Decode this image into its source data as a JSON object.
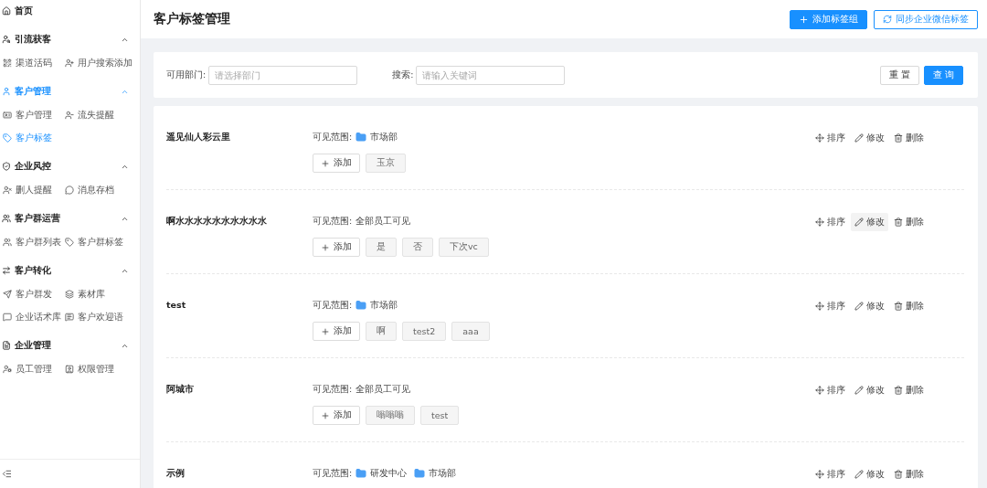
{
  "sidebar": {
    "home": {
      "label": "首页",
      "selected": false
    },
    "groups": [
      {
        "title": "引流获客",
        "expanded": true,
        "selected": false,
        "items": [
          {
            "label": "渠道活码",
            "selected": false
          },
          {
            "label": "用户搜索添加",
            "selected": false
          }
        ]
      },
      {
        "title": "客户管理",
        "expanded": true,
        "selected": true,
        "items": [
          {
            "label": "客户管理",
            "selected": false
          },
          {
            "label": "流失提醒",
            "selected": false
          },
          {
            "label": "客户标签",
            "selected": true
          }
        ]
      },
      {
        "title": "企业风控",
        "expanded": true,
        "selected": false,
        "items": [
          {
            "label": "删人提醒",
            "selected": false
          },
          {
            "label": "消息存档",
            "selected": false
          }
        ]
      },
      {
        "title": "客户群运营",
        "expanded": true,
        "selected": false,
        "items": [
          {
            "label": "客户群列表",
            "selected": false
          },
          {
            "label": "客户群标签",
            "selected": false
          }
        ]
      },
      {
        "title": "客户转化",
        "expanded": true,
        "selected": false,
        "items": [
          {
            "label": "客户群发",
            "selected": false
          },
          {
            "label": "素材库",
            "selected": false
          },
          {
            "label": "企业话术库",
            "selected": false
          },
          {
            "label": "客户欢迎语",
            "selected": false
          }
        ]
      },
      {
        "title": "企业管理",
        "expanded": true,
        "selected": false,
        "items": [
          {
            "label": "员工管理",
            "selected": false
          },
          {
            "label": "权限管理",
            "selected": false
          }
        ]
      }
    ]
  },
  "header": {
    "title": "客户标签管理",
    "buttons": [
      {
        "label": "添加标签组",
        "kind": "primary"
      },
      {
        "label": "同步企业微信标签",
        "kind": "outline"
      }
    ]
  },
  "filter": {
    "fields": [
      {
        "label": "可用部门:",
        "placeholder": "请选择部门"
      },
      {
        "label": "搜索:",
        "placeholder": "请输入关键词"
      }
    ],
    "buttons": [
      {
        "label": "重 置",
        "kind": "default"
      },
      {
        "label": "查 询",
        "kind": "primary"
      }
    ]
  },
  "groups": [
    {
      "name": "遥见仙人彩云里",
      "scope_label": "可见范围:",
      "scope": [
        {
          "text": "市场部",
          "kind": "department"
        }
      ],
      "add_label": "添加",
      "tags": [
        "玉京"
      ],
      "actions": [
        {
          "label": "排序",
          "kind": "sort",
          "hovered": false
        },
        {
          "label": "修改",
          "kind": "edit",
          "hovered": false
        },
        {
          "label": "删除",
          "kind": "delete",
          "hovered": false
        }
      ]
    },
    {
      "name": "啊水水水水水水水水水水",
      "scope_label": "可见范围:",
      "scope": [
        {
          "text": "全部员工可见",
          "kind": "all"
        }
      ],
      "add_label": "添加",
      "tags": [
        "是",
        "否",
        "下次vc"
      ],
      "actions": [
        {
          "label": "排序",
          "kind": "sort",
          "hovered": false
        },
        {
          "label": "修改",
          "kind": "edit",
          "hovered": true
        },
        {
          "label": "删除",
          "kind": "delete",
          "hovered": false
        }
      ]
    },
    {
      "name": "test",
      "scope_label": "可见范围:",
      "scope": [
        {
          "text": "市场部",
          "kind": "department"
        }
      ],
      "add_label": "添加",
      "tags": [
        "啊",
        "test2",
        "aaa"
      ],
      "actions": [
        {
          "label": "排序",
          "kind": "sort",
          "hovered": false
        },
        {
          "label": "修改",
          "kind": "edit",
          "hovered": false
        },
        {
          "label": "删除",
          "kind": "delete",
          "hovered": false
        }
      ]
    },
    {
      "name": "阿城市",
      "scope_label": "可见范围:",
      "scope": [
        {
          "text": "全部员工可见",
          "kind": "all"
        }
      ],
      "add_label": "添加",
      "tags": [
        "嗡嗡嗡",
        "test"
      ],
      "actions": [
        {
          "label": "排序",
          "kind": "sort",
          "hovered": false
        },
        {
          "label": "修改",
          "kind": "edit",
          "hovered": false
        },
        {
          "label": "删除",
          "kind": "delete",
          "hovered": false
        }
      ]
    },
    {
      "name": "示例",
      "scope_label": "可见范围:",
      "scope": [
        {
          "text": "研发中心",
          "kind": "department"
        },
        {
          "text": "市场部",
          "kind": "department"
        }
      ],
      "actions": [
        {
          "label": "排序",
          "kind": "sort",
          "hovered": false
        },
        {
          "label": "修改",
          "kind": "edit",
          "hovered": false
        },
        {
          "label": "删除",
          "kind": "delete",
          "hovered": false
        }
      ]
    }
  ]
}
